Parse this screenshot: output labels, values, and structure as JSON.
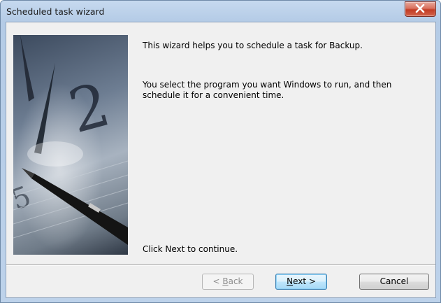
{
  "window": {
    "title": "Scheduled task wizard"
  },
  "content": {
    "intro": "This wizard helps you to schedule a task for Backup.",
    "description": "You select the program you want Windows to run, and then schedule it for a convenient time.",
    "footer": "Click Next to continue."
  },
  "buttons": {
    "back_prefix": "< ",
    "back_mnemonic": "B",
    "back_rest": "ack",
    "next_mnemonic": "N",
    "next_rest": "ext >",
    "cancel": "Cancel"
  },
  "icons": {
    "close": "close-icon",
    "wizard_image": "clock-and-pen-image"
  },
  "colors": {
    "title_bar": "#c6d9ef",
    "close_button": "#c23b24",
    "dialog_background": "#f0f0f0",
    "default_button_border": "#3c7fb1"
  }
}
